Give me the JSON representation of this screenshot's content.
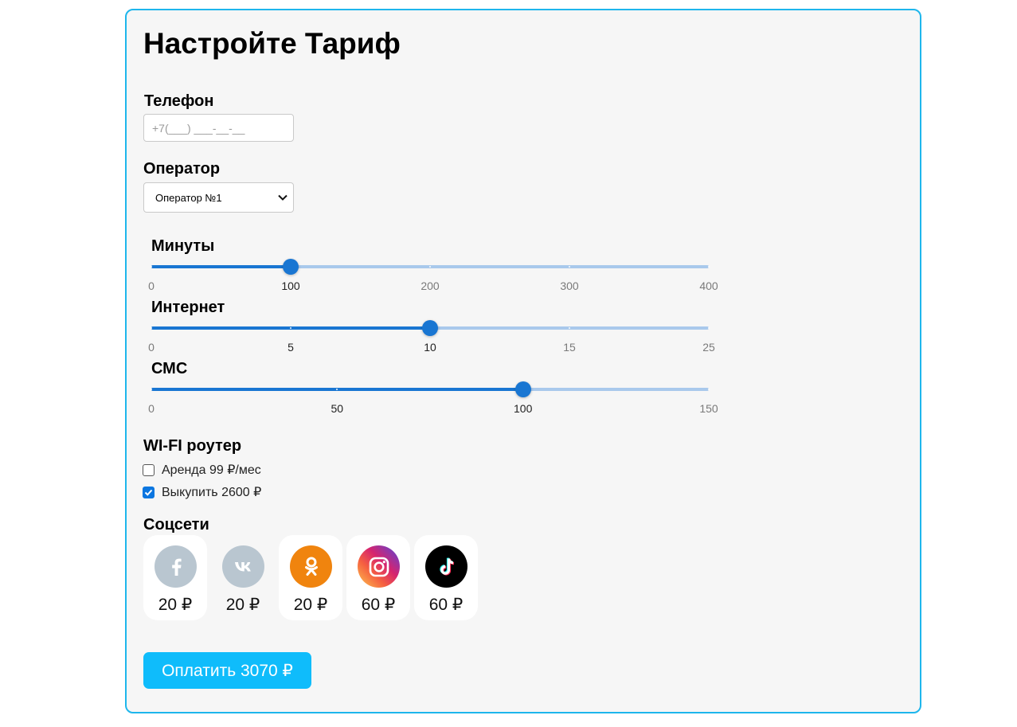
{
  "page": {
    "title": "Настройте Тариф"
  },
  "phone": {
    "label": "Телефон",
    "placeholder": "+7(___) ___-__-__",
    "value": ""
  },
  "operator": {
    "label": "Оператор",
    "selected": "Оператор №1"
  },
  "sliders": {
    "minutes": {
      "label": "Минуты",
      "value": 100,
      "min": 0,
      "max": 400,
      "ticks": [
        "0",
        "100",
        "200",
        "300",
        "400"
      ]
    },
    "internet": {
      "label": "Интернет",
      "value": 10,
      "min": 0,
      "max": 25,
      "ticks": [
        "0",
        "5",
        "10",
        "15",
        "25"
      ]
    },
    "sms": {
      "label": "СМС",
      "value": 100,
      "min": 0,
      "max": 150,
      "ticks": [
        "0",
        "50",
        "100",
        "150"
      ]
    }
  },
  "wifi": {
    "label": "WI-FI роутер",
    "options": [
      {
        "label": "Аренда 99 ₽/мес",
        "checked": false
      },
      {
        "label": "Выкупить 2600 ₽",
        "checked": true
      }
    ]
  },
  "socials": {
    "label": "Соцсети",
    "items": [
      {
        "name": "facebook",
        "icon": "facebook-icon",
        "price": "20 ₽",
        "active": false
      },
      {
        "name": "vk",
        "icon": "vk-icon",
        "price": "20 ₽",
        "active": false
      },
      {
        "name": "odnoklassniki",
        "icon": "odnoklassniki-icon",
        "price": "20 ₽",
        "active": true
      },
      {
        "name": "instagram",
        "icon": "instagram-icon",
        "price": "60 ₽",
        "active": true
      },
      {
        "name": "tiktok",
        "icon": "tiktok-icon",
        "price": "60 ₽",
        "active": true
      }
    ]
  },
  "pay": {
    "label": "Оплатить 3070 ₽"
  },
  "colors": {
    "border": "#1eb6ec",
    "accent": "#1976d2",
    "track": "#a9c9ec",
    "pay_button": "#0fbcfb",
    "checkbox": "#0b76e0",
    "inactive_icon": "#b9c6d0",
    "odnoklassniki": "#f0840e",
    "tiktok": "#000000"
  }
}
